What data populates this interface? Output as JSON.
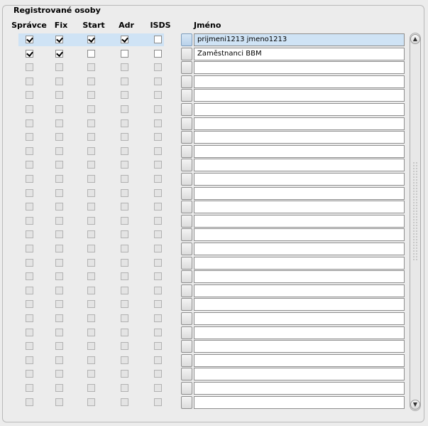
{
  "group": {
    "title": "Registrované osoby"
  },
  "columns": {
    "spravce": "Správce",
    "fix": "Fix",
    "start": "Start",
    "adr": "Adr",
    "isds": "ISDS",
    "jmeno": "Jméno"
  },
  "rows": [
    {
      "spravce": true,
      "fix": true,
      "start": true,
      "adr": true,
      "isds": false,
      "name": "prijmeni1213 jmeno1213",
      "enabled": true,
      "selected": true
    },
    {
      "spravce": true,
      "fix": true,
      "start": false,
      "adr": false,
      "isds": false,
      "name": "Zaměstnanci BBM",
      "enabled": true,
      "selected": false
    },
    {
      "spravce": false,
      "fix": false,
      "start": false,
      "adr": false,
      "isds": false,
      "name": "",
      "enabled": false,
      "selected": false
    },
    {
      "spravce": false,
      "fix": false,
      "start": false,
      "adr": false,
      "isds": false,
      "name": "",
      "enabled": false,
      "selected": false
    },
    {
      "spravce": false,
      "fix": false,
      "start": false,
      "adr": false,
      "isds": false,
      "name": "",
      "enabled": false,
      "selected": false
    },
    {
      "spravce": false,
      "fix": false,
      "start": false,
      "adr": false,
      "isds": false,
      "name": "",
      "enabled": false,
      "selected": false
    },
    {
      "spravce": false,
      "fix": false,
      "start": false,
      "adr": false,
      "isds": false,
      "name": "",
      "enabled": false,
      "selected": false
    },
    {
      "spravce": false,
      "fix": false,
      "start": false,
      "adr": false,
      "isds": false,
      "name": "",
      "enabled": false,
      "selected": false
    },
    {
      "spravce": false,
      "fix": false,
      "start": false,
      "adr": false,
      "isds": false,
      "name": "",
      "enabled": false,
      "selected": false
    },
    {
      "spravce": false,
      "fix": false,
      "start": false,
      "adr": false,
      "isds": false,
      "name": "",
      "enabled": false,
      "selected": false
    },
    {
      "spravce": false,
      "fix": false,
      "start": false,
      "adr": false,
      "isds": false,
      "name": "",
      "enabled": false,
      "selected": false
    },
    {
      "spravce": false,
      "fix": false,
      "start": false,
      "adr": false,
      "isds": false,
      "name": "",
      "enabled": false,
      "selected": false
    },
    {
      "spravce": false,
      "fix": false,
      "start": false,
      "adr": false,
      "isds": false,
      "name": "",
      "enabled": false,
      "selected": false
    },
    {
      "spravce": false,
      "fix": false,
      "start": false,
      "adr": false,
      "isds": false,
      "name": "",
      "enabled": false,
      "selected": false
    },
    {
      "spravce": false,
      "fix": false,
      "start": false,
      "adr": false,
      "isds": false,
      "name": "",
      "enabled": false,
      "selected": false
    },
    {
      "spravce": false,
      "fix": false,
      "start": false,
      "adr": false,
      "isds": false,
      "name": "",
      "enabled": false,
      "selected": false
    },
    {
      "spravce": false,
      "fix": false,
      "start": false,
      "adr": false,
      "isds": false,
      "name": "",
      "enabled": false,
      "selected": false
    },
    {
      "spravce": false,
      "fix": false,
      "start": false,
      "adr": false,
      "isds": false,
      "name": "",
      "enabled": false,
      "selected": false
    },
    {
      "spravce": false,
      "fix": false,
      "start": false,
      "adr": false,
      "isds": false,
      "name": "",
      "enabled": false,
      "selected": false
    },
    {
      "spravce": false,
      "fix": false,
      "start": false,
      "adr": false,
      "isds": false,
      "name": "",
      "enabled": false,
      "selected": false
    },
    {
      "spravce": false,
      "fix": false,
      "start": false,
      "adr": false,
      "isds": false,
      "name": "",
      "enabled": false,
      "selected": false
    },
    {
      "spravce": false,
      "fix": false,
      "start": false,
      "adr": false,
      "isds": false,
      "name": "",
      "enabled": false,
      "selected": false
    },
    {
      "spravce": false,
      "fix": false,
      "start": false,
      "adr": false,
      "isds": false,
      "name": "",
      "enabled": false,
      "selected": false
    },
    {
      "spravce": false,
      "fix": false,
      "start": false,
      "adr": false,
      "isds": false,
      "name": "",
      "enabled": false,
      "selected": false
    },
    {
      "spravce": false,
      "fix": false,
      "start": false,
      "adr": false,
      "isds": false,
      "name": "",
      "enabled": false,
      "selected": false
    },
    {
      "spravce": false,
      "fix": false,
      "start": false,
      "adr": false,
      "isds": false,
      "name": "",
      "enabled": false,
      "selected": false
    },
    {
      "spravce": false,
      "fix": false,
      "start": false,
      "adr": false,
      "isds": false,
      "name": "",
      "enabled": false,
      "selected": false
    }
  ],
  "scrollbar": {
    "up_icon": "arrow-up-icon",
    "down_icon": "arrow-down-icon"
  },
  "colors": {
    "selection": "#cfe3f5",
    "background": "#ececec"
  }
}
